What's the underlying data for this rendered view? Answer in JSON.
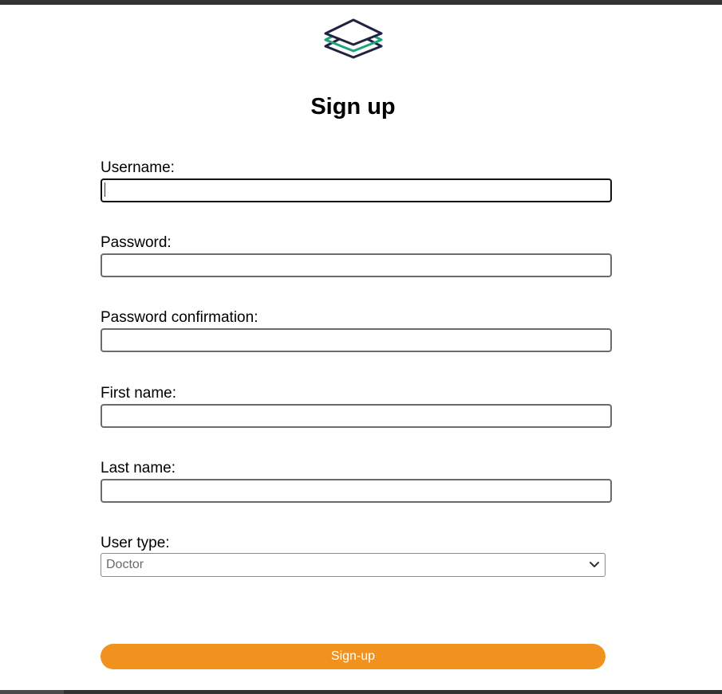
{
  "page": {
    "title": "Sign up"
  },
  "logo": {
    "icon": "layers-icon",
    "colors": {
      "dark": "#1f2340",
      "accent": "#1fa37a"
    }
  },
  "form": {
    "username": {
      "label": "Username:",
      "value": ""
    },
    "password": {
      "label": "Password:",
      "value": ""
    },
    "password_confirmation": {
      "label": "Password confirmation:",
      "value": ""
    },
    "first_name": {
      "label": "First name:",
      "value": ""
    },
    "last_name": {
      "label": "Last name:",
      "value": ""
    },
    "user_type": {
      "label": "User type:",
      "selected": "Doctor",
      "icon": "chevron-down-icon"
    },
    "submit_label": "Sign-up"
  },
  "colors": {
    "button": "#f2921e",
    "frame": "#333333"
  }
}
